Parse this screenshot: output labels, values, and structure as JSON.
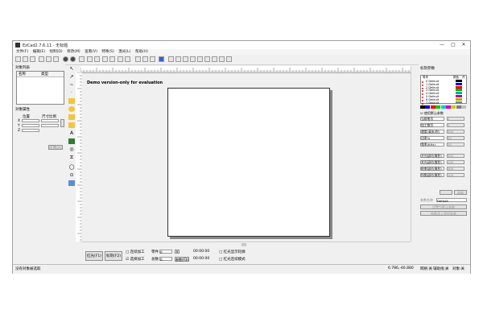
{
  "window": {
    "title": "EzCad2.7.6.11 - 无标题",
    "controls": [
      "—",
      "□",
      "✕"
    ]
  },
  "menu": [
    "文件(F)",
    "编辑(E)",
    "绘制(D)",
    "修改(M)",
    "查看(V)",
    "特殊(S)",
    "激光(L)",
    "帮助(H)"
  ],
  "left_panel": {
    "object_list_title": "对象列表",
    "columns": [
      "名称",
      "类型"
    ],
    "properties_title": "对象属性",
    "position_label": "位置",
    "size_label": "尺寸比例",
    "x_label": "X",
    "y_label": "Y",
    "z_label": "Z",
    "apply_label": "应用(A)"
  },
  "canvas": {
    "demo_text": "Demo version-only for evaluation"
  },
  "bottom_bar": {
    "red_light_label": "红光(F1)",
    "mark_label": "标刻(F2)",
    "continuous_label": "□ 连续加工",
    "parts_label": "零件",
    "parts_value": "0",
    "reset_label": "R",
    "selected_mark_label": "☑ 选择加工",
    "total_label": "总数",
    "total_value": "0",
    "param_label": "参数(F3)",
    "time1": "00:00:00",
    "time2": "00:00:00",
    "red_outline_label": "□ 红光显示轮廓",
    "continuous_red_label": "□ 红光连续模式"
  },
  "right_panel": {
    "title": "标刻参数",
    "pen_header": [
      "笔号",
      "颜色",
      "开"
    ],
    "pens": [
      {
        "name": "0 Default",
        "color": "#000000"
      },
      {
        "name": "1 Default",
        "color": "#0000ff"
      },
      {
        "name": "2 Default",
        "color": "#ff0000"
      },
      {
        "name": "3 Default",
        "color": "#00aa00"
      },
      {
        "name": "4 Default",
        "color": "#00aaaa"
      },
      {
        "name": "5 Default",
        "color": "#aa00aa"
      },
      {
        "name": "6 Default",
        "color": "#aaaa00"
      },
      {
        "name": "7 Default",
        "color": "#808080"
      }
    ],
    "palette": [
      "#000000",
      "#0000ff",
      "#ff0000",
      "#00cc00",
      "#00cccc",
      "#cc00cc",
      "#cccc00",
      "#808080",
      "#c0c0c0"
    ],
    "use_default_label": "☑ 使用默认参数",
    "params": [
      {
        "label": "当前笔号",
        "value": "0"
      },
      {
        "label": "加工数目",
        "value": "1"
      },
      {
        "label": "速度(毫米/秒)",
        "value": "500"
      },
      {
        "label": "功率%",
        "value": "50"
      },
      {
        "label": "频率(KHz)",
        "value": "20"
      },
      {
        "label": "开光延时(微秒)",
        "value": "300"
      },
      {
        "label": "关光延时(微秒)",
        "value": "100"
      },
      {
        "label": "结束延时(微秒)",
        "value": "300"
      },
      {
        "label": "拐角延时(微秒)",
        "value": "100"
      }
    ],
    "advanced_label": "高级",
    "param_name_label": "参数名称",
    "param_name_value": "Default",
    "set_default_label": "设置为默认参数",
    "load_label": "参数读入到所有笔"
  },
  "status": {
    "left": "没有对象被选取",
    "coords": "6.786,-46.880",
    "grid": "网格:关",
    "guide": "辅助线:关",
    "snap": "对象:关"
  }
}
